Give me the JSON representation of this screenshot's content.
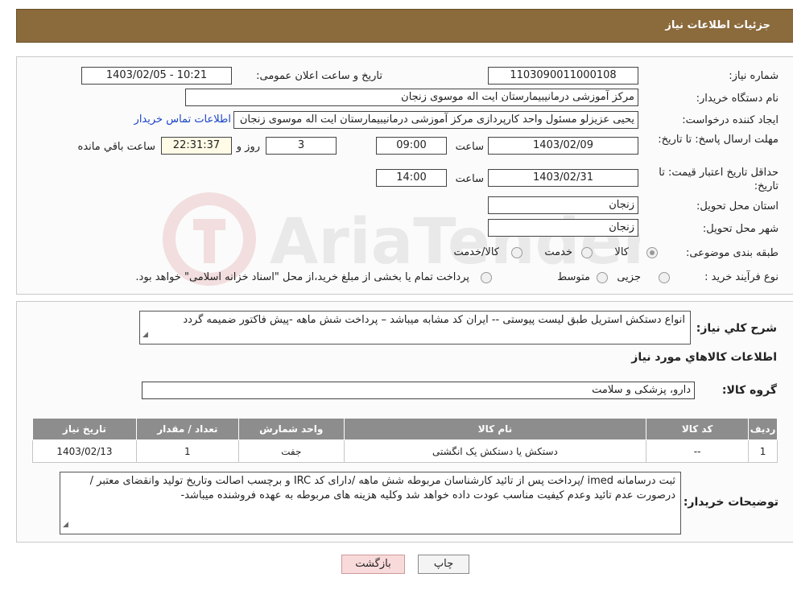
{
  "header": {
    "title": "جزئیات اطلاعات نیاز"
  },
  "form": {
    "need_number_label": "شماره نیاز:",
    "need_number": "1103090011000108",
    "announce_label": "تاریخ و ساعت اعلان عمومی:",
    "announce_value": "1403/02/05 - 10:21",
    "buyer_org_label": "نام دستگاه خریدار:",
    "buyer_org": "مرکز آموزشی درمانیبیمارستان ایت اله موسوی زنجان",
    "creator_label": "ایجاد کننده درخواست:",
    "creator": "یحیی عزیزلو مسئول واحد کارپردازی مرکز آموزشی درمانیبیمارستان ایت اله موسوی زنجان",
    "contact_link": "اطلاعات تماس خریدار",
    "deadline_label": "مهلت ارسال پاسخ: تا تاریخ:",
    "deadline_date": "1403/02/09",
    "time_label": "ساعت",
    "deadline_time": "09:00",
    "days_value": "3",
    "days_label": "روز و",
    "remaining_time": "22:31:37",
    "remaining_label": "ساعت باقي مانده",
    "validity_label": "حداقل تاریخ اعتبار قیمت: تا تاریخ:",
    "validity_date": "1403/02/31",
    "validity_time": "14:00",
    "province_label": "استان محل تحویل:",
    "province": "زنجان",
    "city_label": "شهر محل تحویل:",
    "city": "زنجان",
    "category_label": "طبقه بندی موضوعی:",
    "category_options": [
      "کالا",
      "خدمت",
      "کالا/خدمت"
    ],
    "category_selected": "کالا",
    "process_label": "نوع فرآیند خرید :",
    "process_options": [
      "جزیی",
      "متوسط"
    ],
    "payment_note": "پرداخت تمام یا بخشی از مبلغ خرید،از محل \"اسناد خزانه اسلامی\" خواهد بود."
  },
  "details": {
    "summary_label": "شرح کلي نياز:",
    "summary": "انواع دستکش استریل طبق لیست پیوستی -- ایران کد مشابه میباشد – پرداخت شش ماهه -پیش فاکتور ضمیمه گردد",
    "goods_info_title": "اطلاعات کالاهاي مورد نياز",
    "goods_group_label": "گروه کالا:",
    "goods_group": "دارو، پزشکی و سلامت",
    "table": {
      "headers": [
        "رديف",
        "کد کالا",
        "نام کالا",
        "واحد شمارش",
        "تعداد / مقدار",
        "تاريخ نياز"
      ],
      "rows": [
        [
          "1",
          "--",
          "دستکش یا دستکش یک انگشتی",
          "جفت",
          "1",
          "1403/02/13"
        ]
      ]
    },
    "buyer_notes_label": "توضیحات خریدار:",
    "buyer_notes": "ثبت درسامانه imed /پرداخت پس از تائید کارشناسان مربوطه  شش ماهه /دارای کد IRC  و برچسب اصالت وتاریخ تولید وانقضای معتبر /درصورت عدم تائید وعدم کیفیت مناسب عودت داده خواهد شد وکلیه هزینه های مربوطه به عهده فروشنده میباشد-"
  },
  "buttons": {
    "print": "چاپ",
    "back": "بازگشت"
  },
  "watermark": {
    "text": "AriaTender.neT"
  },
  "colors": {
    "header_bg": "#8b6a3c",
    "link": "#1a44c9",
    "table_header": "#8d8d8d",
    "back_button_bg": "#f9dada"
  }
}
